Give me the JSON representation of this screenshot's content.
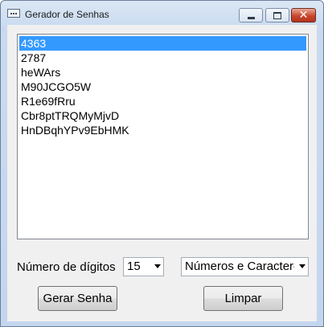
{
  "window": {
    "title": "Gerador de Senhas",
    "controls": {
      "minimize": "minimize-icon",
      "maximize": "maximize-icon",
      "close": "close-icon"
    }
  },
  "passwords": {
    "items": [
      "4363",
      "2787",
      "heWArs",
      "M90JCGO5W",
      "R1e69fRru",
      "Cbr8ptTRQMyMjvD",
      "HnDBqhYPv9EbHMK"
    ],
    "selected_index": 0
  },
  "digits": {
    "label": "Número de dígitos",
    "value": "15"
  },
  "charset": {
    "value": "Números e Caracteres"
  },
  "buttons": {
    "generate": "Gerar Senha",
    "clear": "Limpar"
  },
  "colors": {
    "selection": "#3399ff",
    "close_button": "#c9462c"
  }
}
